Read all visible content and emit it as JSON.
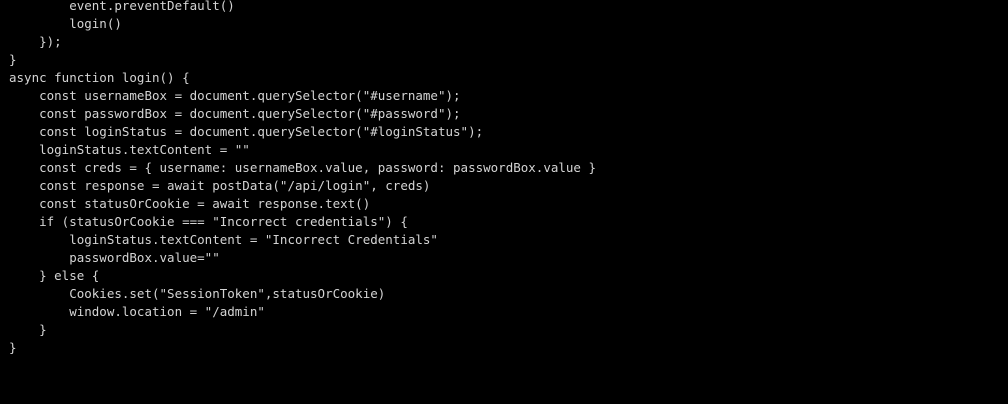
{
  "code": {
    "lines": [
      "        event.preventDefault()",
      "        login()",
      "    });",
      "}",
      "async function login() {",
      "    const usernameBox = document.querySelector(\"#username\");",
      "    const passwordBox = document.querySelector(\"#password\");",
      "    const loginStatus = document.querySelector(\"#loginStatus\");",
      "    loginStatus.textContent = \"\"",
      "    const creds = { username: usernameBox.value, password: passwordBox.value }",
      "    const response = await postData(\"/api/login\", creds)",
      "    const statusOrCookie = await response.text()",
      "    if (statusOrCookie === \"Incorrect credentials\") {",
      "        loginStatus.textContent = \"Incorrect Credentials\"",
      "        passwordBox.value=\"\"",
      "    } else {",
      "        Cookies.set(\"SessionToken\",statusOrCookie)",
      "        window.location = \"/admin\"",
      "    }",
      "}"
    ]
  },
  "colors": {
    "background": "#000000",
    "text": "#d4d4d4"
  }
}
